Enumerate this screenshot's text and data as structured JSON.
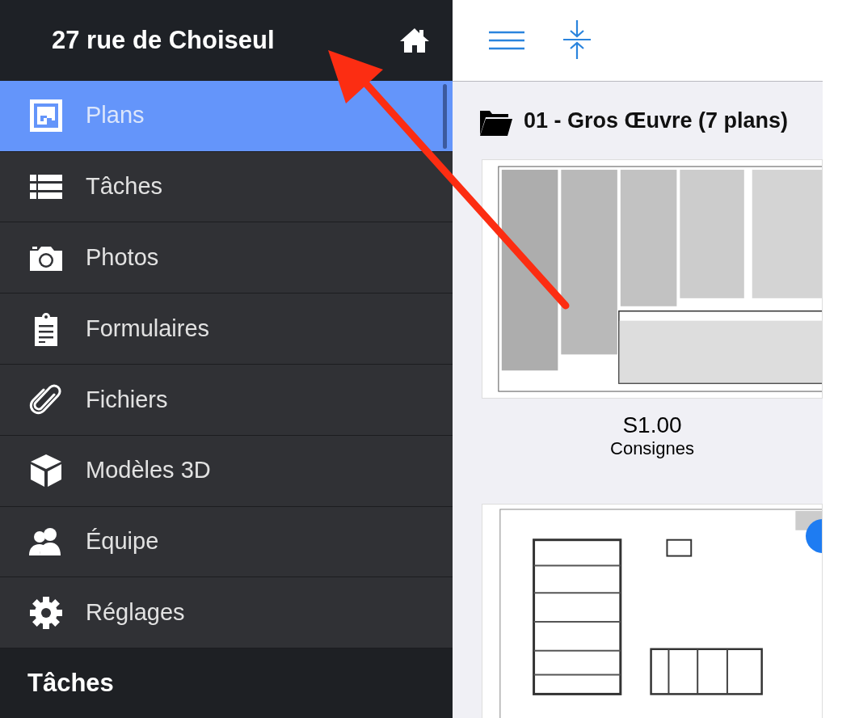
{
  "sidebar": {
    "title": "27 rue de Choiseul",
    "items": [
      {
        "label": "Plans",
        "kind": "plan",
        "selected": true
      },
      {
        "label": "Tâches",
        "kind": "list",
        "selected": false
      },
      {
        "label": "Photos",
        "kind": "camera",
        "selected": false
      },
      {
        "label": "Formulaires",
        "kind": "clipboard",
        "selected": false
      },
      {
        "label": "Fichiers",
        "kind": "paperclip",
        "selected": false
      },
      {
        "label": "Modèles 3D",
        "kind": "cube",
        "selected": false
      },
      {
        "label": "Équipe",
        "kind": "people",
        "selected": false
      },
      {
        "label": "Réglages",
        "kind": "gear",
        "selected": false
      }
    ],
    "section_title": "Tâches"
  },
  "folder": {
    "title": "01 - Gros Œuvre (7 plans)"
  },
  "plans": [
    {
      "kind": "notes",
      "number": "S1.00",
      "name": "Consignes",
      "badge": false
    },
    {
      "kind": "floorplan",
      "badge": true
    }
  ]
}
